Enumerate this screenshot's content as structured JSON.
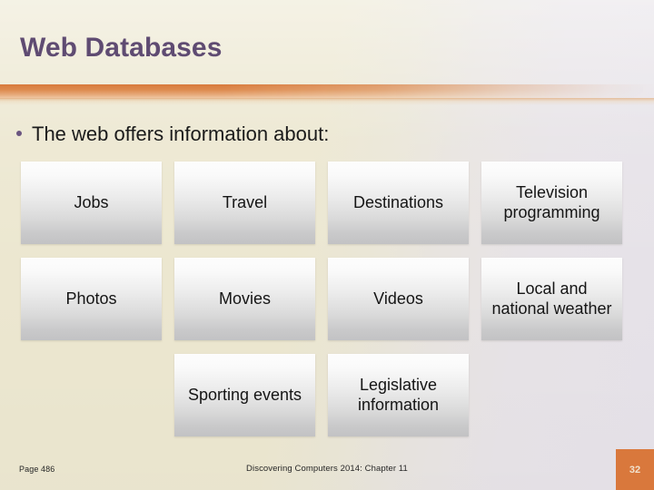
{
  "slide": {
    "title": "Web Databases",
    "bullet": "The web offers information about:",
    "bullet_marker": "bullet-dot",
    "colors": {
      "title": "#5f4b72",
      "bullet_marker": "#6a5580",
      "divider_orange": "#d87a3c",
      "page_badge_bg": "#d9783c",
      "background_left": "#ece7d0",
      "background_right": "#e6e2e9",
      "box_top": "#fdfdfd",
      "box_bottom": "#c2c2c4"
    }
  },
  "grid": {
    "columns": 4,
    "rows": 3,
    "cells": [
      {
        "label": "Jobs",
        "empty": false
      },
      {
        "label": "Travel",
        "empty": false
      },
      {
        "label": "Destinations",
        "empty": false
      },
      {
        "label": "Television programming",
        "empty": false
      },
      {
        "label": "Photos",
        "empty": false
      },
      {
        "label": "Movies",
        "empty": false
      },
      {
        "label": "Videos",
        "empty": false
      },
      {
        "label": "Local and national weather",
        "empty": false
      },
      {
        "label": "",
        "empty": true
      },
      {
        "label": "Sporting events",
        "empty": false
      },
      {
        "label": "Legislative information",
        "empty": false
      },
      {
        "label": "",
        "empty": true
      }
    ]
  },
  "footer": {
    "left": "Page 486",
    "center": "Discovering Computers 2014: Chapter 11",
    "page_number": "32"
  }
}
